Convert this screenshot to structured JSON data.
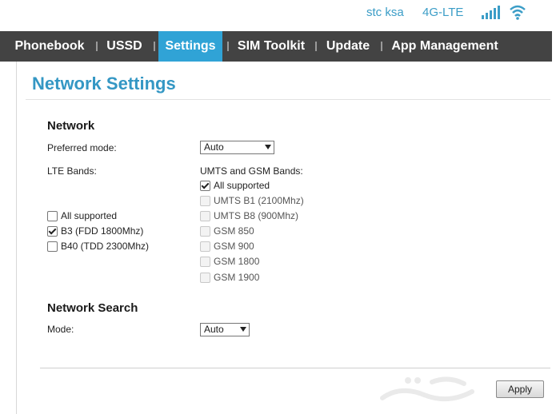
{
  "status": {
    "carrier": "stc ksa",
    "network_type": "4G-LTE",
    "accent_color": "#3b9dc7"
  },
  "nav": {
    "items": [
      {
        "label": "Phonebook",
        "active": false
      },
      {
        "label": "USSD",
        "active": false
      },
      {
        "label": "Settings",
        "active": true
      },
      {
        "label": "SIM Toolkit",
        "active": false
      },
      {
        "label": "Update",
        "active": false
      },
      {
        "label": "App Management",
        "active": false
      }
    ],
    "background": "#434343",
    "active_color": "#30a3d6"
  },
  "page": {
    "title": "Network Settings"
  },
  "network": {
    "section_title": "Network",
    "preferred_mode_label": "Preferred mode:",
    "preferred_mode_value": "Auto",
    "lte_bands_label": "LTE Bands:",
    "lte_bands": [
      {
        "label": "All supported",
        "checked": false
      },
      {
        "label": "B3 (FDD 1800Mhz)",
        "checked": true
      },
      {
        "label": "B40 (TDD 2300Mhz)",
        "checked": false
      }
    ],
    "umts_gsm_label": "UMTS and GSM Bands:",
    "umts_gsm_bands": [
      {
        "label": "All supported",
        "checked": true,
        "disabled": false
      },
      {
        "label": "UMTS B1 (2100Mhz)",
        "checked": false,
        "disabled": true
      },
      {
        "label": "UMTS B8 (900Mhz)",
        "checked": false,
        "disabled": true
      },
      {
        "label": "GSM 850",
        "checked": false,
        "disabled": true
      },
      {
        "label": "GSM 900",
        "checked": false,
        "disabled": true
      },
      {
        "label": "GSM 1800",
        "checked": false,
        "disabled": true
      },
      {
        "label": "GSM 1900",
        "checked": false,
        "disabled": true
      }
    ]
  },
  "network_search": {
    "section_title": "Network Search",
    "mode_label": "Mode:",
    "mode_value": "Auto"
  },
  "actions": {
    "apply_label": "Apply"
  }
}
